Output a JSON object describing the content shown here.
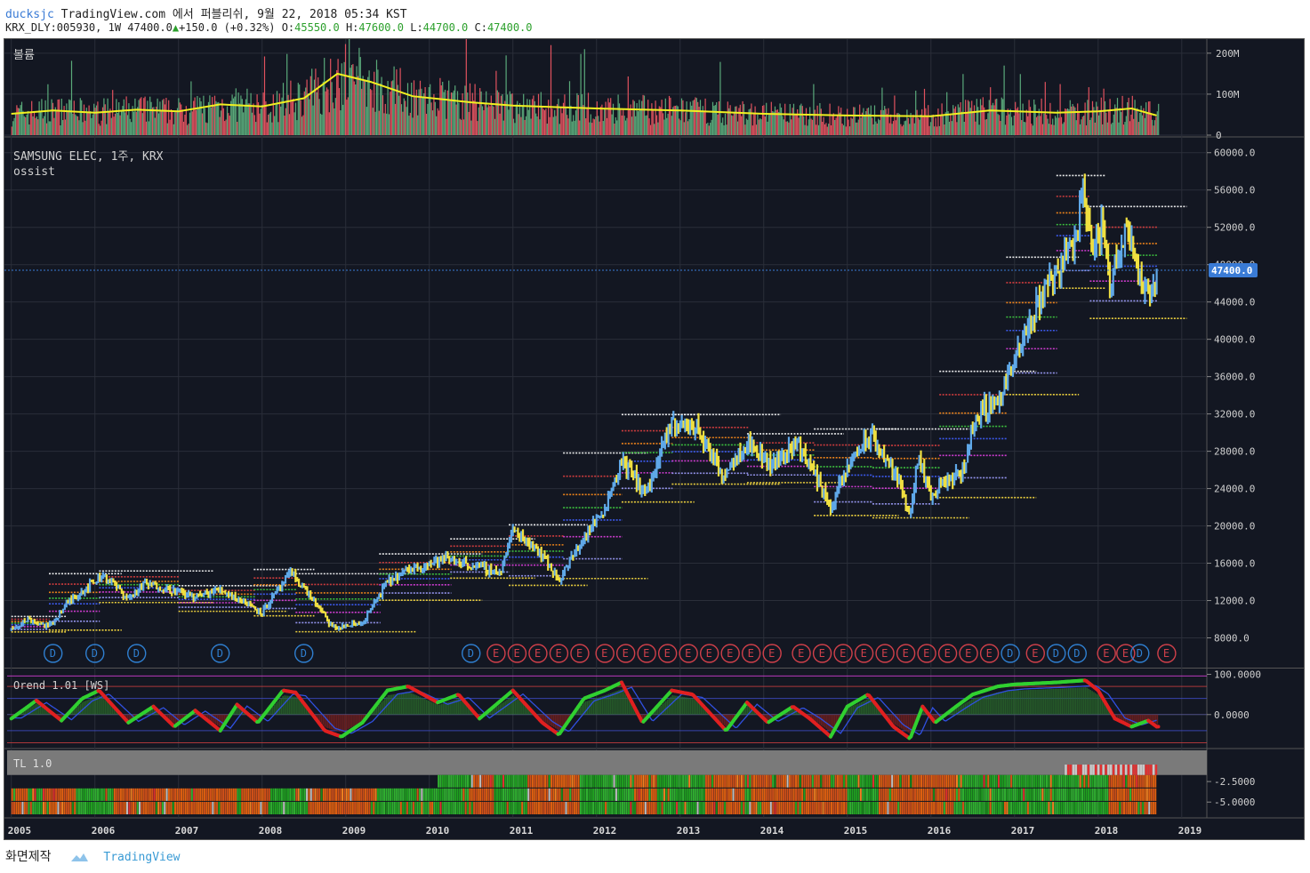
{
  "header": {
    "user": "ducksjc",
    "published": "TradingView.com 에서 퍼블리쉬, 9월 22, 2018 05:34 KST",
    "symbol_line": "KRX_DLY:005930, 1W 47400.0",
    "change": "+150.0 (+0.32%)",
    "o_label": "O:",
    "o_val": "45550.0",
    "h_label": "H:",
    "h_val": "47600.0",
    "l_label": "L:",
    "l_val": "44700.0",
    "c_label": "C:",
    "c_val": "47400.0"
  },
  "footer": {
    "made_with": "화면제작",
    "brand": "TradingView"
  },
  "colors": {
    "bg": "#131722",
    "grid": "#2a2e39",
    "up": "#5fa8e8",
    "down": "#f0e040",
    "vol_up": "#5aa97a",
    "vol_down": "#e0525e",
    "vol_ma": "#f0f020",
    "price_line": "#3a7bd5"
  },
  "chart_data": [
    {
      "type": "bar",
      "panel": "volume",
      "title": "볼륨",
      "y_ticks": [
        "200M",
        "100M",
        "0"
      ],
      "y_tick_values": [
        200,
        100,
        0
      ],
      "ylim": [
        0,
        230
      ],
      "unit": "M",
      "ma_points": [
        [
          2005.0,
          52
        ],
        [
          2005.5,
          60
        ],
        [
          2006.0,
          55
        ],
        [
          2006.5,
          62
        ],
        [
          2007.0,
          58
        ],
        [
          2007.5,
          75
        ],
        [
          2008.0,
          70
        ],
        [
          2008.5,
          90
        ],
        [
          2008.9,
          150
        ],
        [
          2009.3,
          130
        ],
        [
          2009.8,
          95
        ],
        [
          2010.5,
          80
        ],
        [
          2011.0,
          72
        ],
        [
          2012.0,
          65
        ],
        [
          2013.0,
          60
        ],
        [
          2014.0,
          52
        ],
        [
          2015.0,
          48
        ],
        [
          2016.0,
          46
        ],
        [
          2016.7,
          60
        ],
        [
          2017.5,
          55
        ],
        [
          2018.0,
          58
        ],
        [
          2018.4,
          65
        ],
        [
          2018.7,
          48
        ]
      ]
    },
    {
      "type": "line",
      "panel": "price",
      "title": "SAMSUNG ELEC, 1주, KRX",
      "subtitle": "ossist",
      "x_ticks": [
        "2005",
        "2006",
        "2007",
        "2008",
        "2009",
        "2010",
        "2011",
        "2012",
        "2013",
        "2014",
        "2015",
        "2016",
        "2017",
        "2018",
        "2019"
      ],
      "x_tick_values": [
        2005,
        2006,
        2007,
        2008,
        2009,
        2010,
        2011,
        2012,
        2013,
        2014,
        2015,
        2016,
        2017,
        2018,
        2019
      ],
      "y_ticks": [
        "60000.0",
        "56000.0",
        "52000.0",
        "48000.0",
        "44000.0",
        "40000.0",
        "36000.0",
        "32000.0",
        "28000.0",
        "24000.0",
        "20000.0",
        "16000.0",
        "12000.0",
        "8000.0"
      ],
      "y_tick_values": [
        60000,
        56000,
        52000,
        48000,
        44000,
        40000,
        36000,
        32000,
        28000,
        24000,
        20000,
        16000,
        12000,
        8000
      ],
      "ylim": [
        5000,
        61500
      ],
      "xlim": [
        2004.95,
        2019.3
      ],
      "last_price": "47400.0",
      "last_value": 47400,
      "points": [
        [
          2005.0,
          9000
        ],
        [
          2005.2,
          10000
        ],
        [
          2005.45,
          9200
        ],
        [
          2005.7,
          12000
        ],
        [
          2006.1,
          14800
        ],
        [
          2006.4,
          12200
        ],
        [
          2006.6,
          13800
        ],
        [
          2006.9,
          13200
        ],
        [
          2007.2,
          12400
        ],
        [
          2007.5,
          13200
        ],
        [
          2007.8,
          11800
        ],
        [
          2008.0,
          10800
        ],
        [
          2008.35,
          15000
        ],
        [
          2008.6,
          12200
        ],
        [
          2008.85,
          9000
        ],
        [
          2009.2,
          9600
        ],
        [
          2009.5,
          14000
        ],
        [
          2009.8,
          15500
        ],
        [
          2010.2,
          16500
        ],
        [
          2010.5,
          15800
        ],
        [
          2010.85,
          15000
        ],
        [
          2011.0,
          19600
        ],
        [
          2011.3,
          17500
        ],
        [
          2011.55,
          14200
        ],
        [
          2011.8,
          18000
        ],
        [
          2012.1,
          22000
        ],
        [
          2012.3,
          27000
        ],
        [
          2012.6,
          23500
        ],
        [
          2012.9,
          31000
        ],
        [
          2013.2,
          30500
        ],
        [
          2013.5,
          25500
        ],
        [
          2013.8,
          29000
        ],
        [
          2014.1,
          26500
        ],
        [
          2014.4,
          29000
        ],
        [
          2014.7,
          24000
        ],
        [
          2014.8,
          22000
        ],
        [
          2015.1,
          28000
        ],
        [
          2015.3,
          29500
        ],
        [
          2015.6,
          25000
        ],
        [
          2015.75,
          21500
        ],
        [
          2015.85,
          27000
        ],
        [
          2016.0,
          23000
        ],
        [
          2016.2,
          25000
        ],
        [
          2016.35,
          25200
        ],
        [
          2016.55,
          32000
        ],
        [
          2016.8,
          33500
        ],
        [
          2017.0,
          37500
        ],
        [
          2017.2,
          42000
        ],
        [
          2017.35,
          45500
        ],
        [
          2017.55,
          48000
        ],
        [
          2017.75,
          51500
        ],
        [
          2017.83,
          56500
        ],
        [
          2017.92,
          49500
        ],
        [
          2018.05,
          52000
        ],
        [
          2018.15,
          46000
        ],
        [
          2018.35,
          53000
        ],
        [
          2018.5,
          46500
        ],
        [
          2018.6,
          44000
        ],
        [
          2018.7,
          47400
        ]
      ],
      "event_labels": [
        {
          "x": 2005.5,
          "label": "D",
          "kind": "dividend"
        },
        {
          "x": 2006.0,
          "label": "D",
          "kind": "dividend"
        },
        {
          "x": 2006.5,
          "label": "D",
          "kind": "dividend"
        },
        {
          "x": 2007.5,
          "label": "D",
          "kind": "dividend"
        },
        {
          "x": 2008.5,
          "label": "D",
          "kind": "dividend"
        },
        {
          "x": 2010.5,
          "label": "D",
          "kind": "dividend"
        },
        {
          "x": 2010.8,
          "label": "E",
          "kind": "earnings"
        },
        {
          "x": 2011.05,
          "label": "E",
          "kind": "earnings"
        },
        {
          "x": 2011.3,
          "label": "E",
          "kind": "earnings"
        },
        {
          "x": 2011.55,
          "label": "E",
          "kind": "earnings"
        },
        {
          "x": 2011.8,
          "label": "E",
          "kind": "earnings"
        },
        {
          "x": 2012.1,
          "label": "E",
          "kind": "earnings"
        },
        {
          "x": 2012.35,
          "label": "E",
          "kind": "earnings"
        },
        {
          "x": 2012.6,
          "label": "E",
          "kind": "earnings"
        },
        {
          "x": 2012.85,
          "label": "E",
          "kind": "earnings"
        },
        {
          "x": 2013.1,
          "label": "E",
          "kind": "earnings"
        },
        {
          "x": 2013.35,
          "label": "E",
          "kind": "earnings"
        },
        {
          "x": 2013.6,
          "label": "E",
          "kind": "earnings"
        },
        {
          "x": 2013.85,
          "label": "E",
          "kind": "earnings"
        },
        {
          "x": 2014.1,
          "label": "E",
          "kind": "earnings"
        },
        {
          "x": 2014.45,
          "label": "E",
          "kind": "earnings"
        },
        {
          "x": 2014.7,
          "label": "E",
          "kind": "earnings"
        },
        {
          "x": 2014.95,
          "label": "E",
          "kind": "earnings"
        },
        {
          "x": 2015.2,
          "label": "E",
          "kind": "earnings"
        },
        {
          "x": 2015.45,
          "label": "E",
          "kind": "earnings"
        },
        {
          "x": 2015.7,
          "label": "E",
          "kind": "earnings"
        },
        {
          "x": 2015.95,
          "label": "E",
          "kind": "earnings"
        },
        {
          "x": 2016.2,
          "label": "E",
          "kind": "earnings"
        },
        {
          "x": 2016.45,
          "label": "E",
          "kind": "earnings"
        },
        {
          "x": 2016.7,
          "label": "E",
          "kind": "earnings"
        },
        {
          "x": 2016.95,
          "label": "D",
          "kind": "dividend"
        },
        {
          "x": 2017.25,
          "label": "E",
          "kind": "earnings"
        },
        {
          "x": 2017.5,
          "label": "D",
          "kind": "dividend"
        },
        {
          "x": 2017.75,
          "label": "D",
          "kind": "dividend"
        },
        {
          "x": 2018.1,
          "label": "E",
          "kind": "earnings"
        },
        {
          "x": 2018.33,
          "label": "E",
          "kind": "earnings"
        },
        {
          "x": 2018.5,
          "label": "D",
          "kind": "dividend"
        },
        {
          "x": 2018.82,
          "label": "E",
          "kind": "earnings"
        }
      ]
    },
    {
      "type": "line",
      "panel": "oscillator",
      "title": "Orend 1.01 [WS]",
      "y_ticks": [
        "100.0000",
        "0.0000"
      ],
      "y_tick_values": [
        100,
        0
      ],
      "ylim": [
        -80,
        110
      ],
      "points": [
        [
          2005.0,
          -10
        ],
        [
          2005.3,
          35
        ],
        [
          2005.6,
          -15
        ],
        [
          2005.85,
          40
        ],
        [
          2006.05,
          60
        ],
        [
          2006.4,
          -20
        ],
        [
          2006.7,
          20
        ],
        [
          2006.95,
          -30
        ],
        [
          2007.2,
          10
        ],
        [
          2007.5,
          -40
        ],
        [
          2007.7,
          25
        ],
        [
          2007.95,
          -20
        ],
        [
          2008.25,
          60
        ],
        [
          2008.4,
          55
        ],
        [
          2008.75,
          -40
        ],
        [
          2008.95,
          -55
        ],
        [
          2009.2,
          -20
        ],
        [
          2009.5,
          60
        ],
        [
          2009.75,
          70
        ],
        [
          2010.1,
          30
        ],
        [
          2010.35,
          50
        ],
        [
          2010.6,
          -10
        ],
        [
          2011.0,
          60
        ],
        [
          2011.35,
          -20
        ],
        [
          2011.55,
          -50
        ],
        [
          2011.85,
          40
        ],
        [
          2012.1,
          60
        ],
        [
          2012.3,
          80
        ],
        [
          2012.55,
          -20
        ],
        [
          2012.9,
          60
        ],
        [
          2013.15,
          50
        ],
        [
          2013.55,
          -40
        ],
        [
          2013.8,
          30
        ],
        [
          2014.05,
          -20
        ],
        [
          2014.35,
          20
        ],
        [
          2014.55,
          -10
        ],
        [
          2014.8,
          -55
        ],
        [
          2015.0,
          20
        ],
        [
          2015.25,
          50
        ],
        [
          2015.55,
          -30
        ],
        [
          2015.75,
          -60
        ],
        [
          2015.9,
          20
        ],
        [
          2016.05,
          -20
        ],
        [
          2016.3,
          20
        ],
        [
          2016.5,
          50
        ],
        [
          2016.8,
          70
        ],
        [
          2017.0,
          75
        ],
        [
          2017.5,
          80
        ],
        [
          2017.85,
          85
        ],
        [
          2018.0,
          60
        ],
        [
          2018.2,
          -10
        ],
        [
          2018.4,
          -30
        ],
        [
          2018.6,
          -15
        ],
        [
          2018.7,
          -30
        ]
      ]
    },
    {
      "type": "heatmap",
      "panel": "tl",
      "title": "TL 1.0",
      "y_ticks": [
        "-2.5000",
        "-5.0000"
      ],
      "y_tick_values": [
        -2.5,
        -5
      ],
      "ylim": [
        -6.6,
        1.3
      ],
      "rows": 3
    }
  ]
}
